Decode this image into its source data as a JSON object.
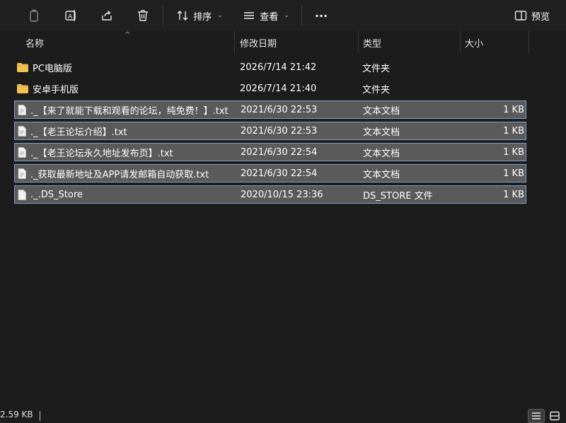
{
  "toolbar": {
    "sort_label": "排序",
    "view_label": "查看",
    "more_label": "···",
    "preview_label": "预览"
  },
  "columns": {
    "name": "名称",
    "modified": "修改日期",
    "type": "类型",
    "size": "大小"
  },
  "files": [
    {
      "name": "PC电脑版",
      "modified": "2026/7/14 21:42",
      "type": "文件夹",
      "size": "",
      "kind": "folder",
      "selected": false
    },
    {
      "name": "安卓手机版",
      "modified": "2026/7/14 21:40",
      "type": "文件夹",
      "size": "",
      "kind": "folder",
      "selected": false
    },
    {
      "name": "._【来了就能下载和观看的论坛，纯免费！】.txt",
      "modified": "2021/6/30 22:53",
      "type": "文本文档",
      "size": "1 KB",
      "kind": "file",
      "selected": true
    },
    {
      "name": "._【老王论坛介绍】.txt",
      "modified": "2021/6/30 22:53",
      "type": "文本文档",
      "size": "1 KB",
      "kind": "file",
      "selected": true
    },
    {
      "name": "._【老王论坛永久地址发布页】.txt",
      "modified": "2021/6/30 22:54",
      "type": "文本文档",
      "size": "1 KB",
      "kind": "file",
      "selected": true
    },
    {
      "name": "._获取最新地址及APP请发邮箱自动获取.txt",
      "modified": "2021/6/30 22:54",
      "type": "文本文档",
      "size": "1 KB",
      "kind": "file",
      "selected": true
    },
    {
      "name": "._.DS_Store",
      "modified": "2020/10/15 23:36",
      "type": "DS_STORE 文件",
      "size": "1 KB",
      "kind": "file",
      "selected": true
    }
  ],
  "status": {
    "selection_size": "2.59 KB"
  },
  "colors": {
    "background": "#1c1c1c",
    "toolbar": "#202020",
    "selection": "#5a5a5a",
    "selection_border": "#7fa2c4",
    "folder": "#f4c04e"
  }
}
